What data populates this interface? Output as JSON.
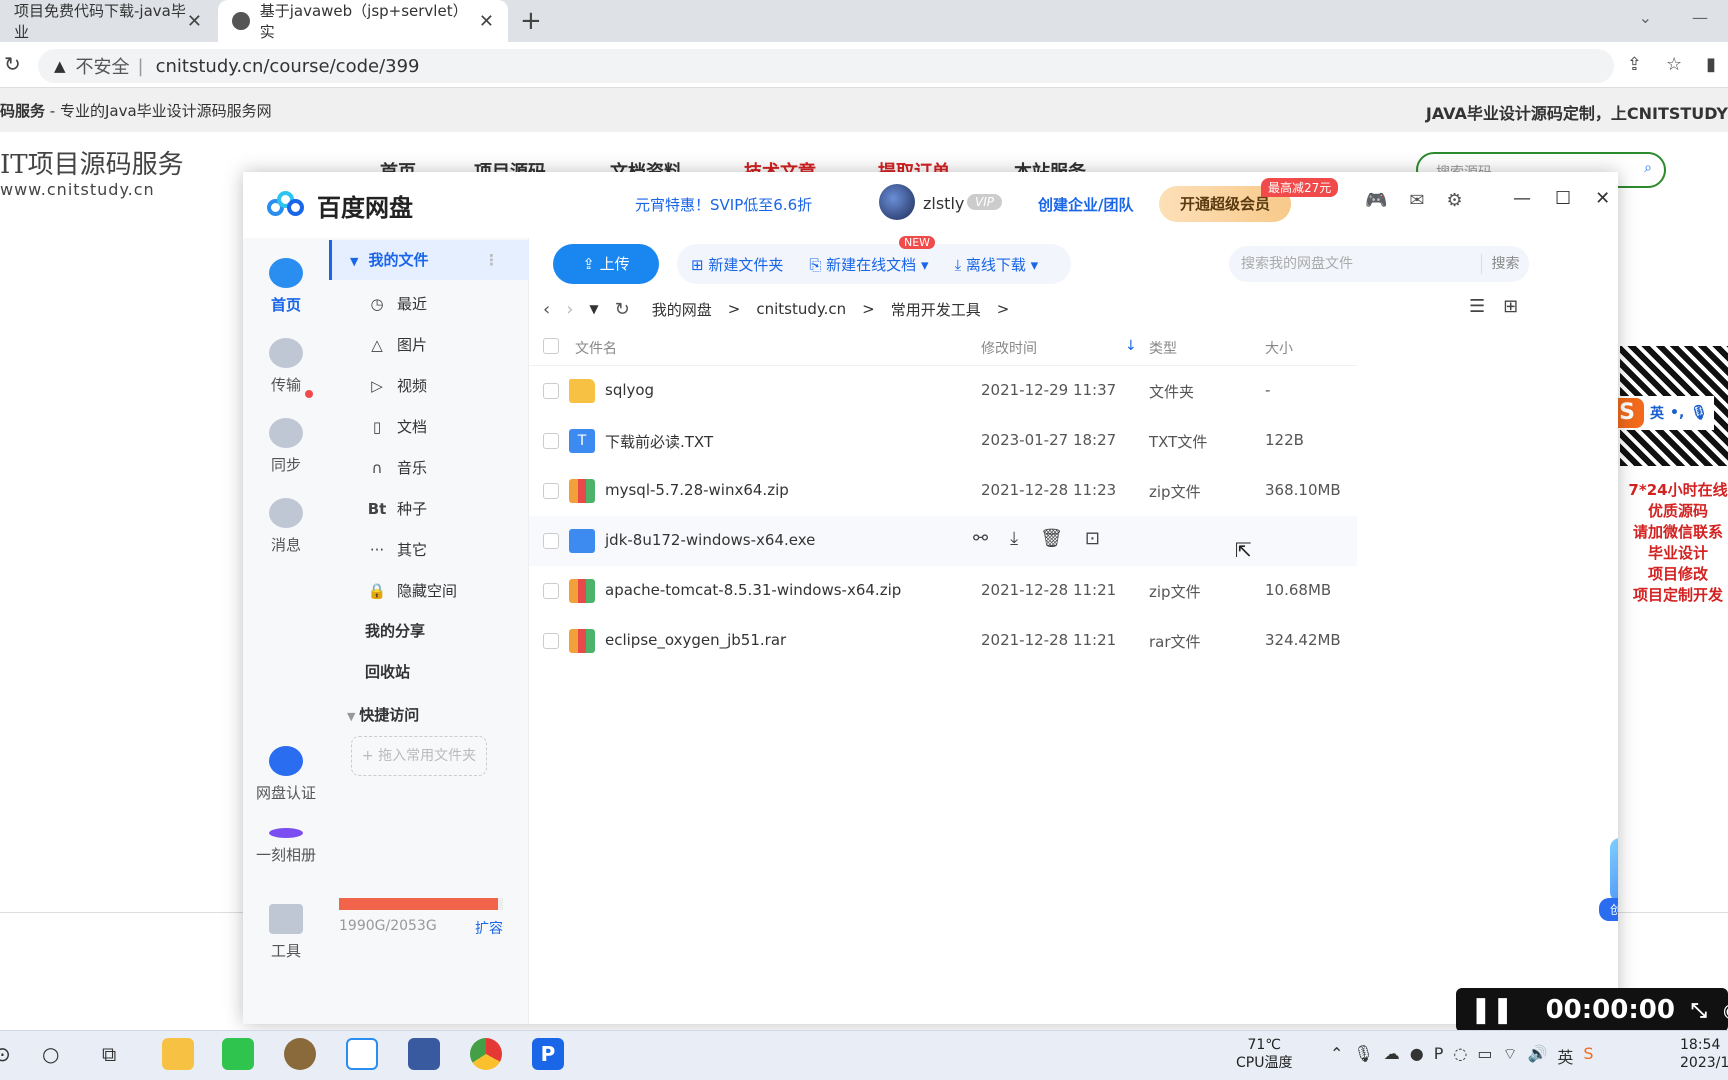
{
  "browser": {
    "tabs": [
      {
        "title": "项目免费代码下载-java毕业"
      },
      {
        "title": "基于javaweb（jsp+servlet）实"
      }
    ],
    "address": {
      "security": "不安全",
      "url": "cnitstudy.cn/course/code/399"
    }
  },
  "site": {
    "band_left_bold": "码服务",
    "band_left": " - 专业的Java毕业设计源码服务网",
    "band_right": "JAVA毕业设计源码定制，上CNITSTUDY",
    "logo": "IT项目源码服务",
    "logo_url": "www.cnitstudy.cn",
    "nav": [
      "首页",
      "项目源码",
      "文档资料",
      "技术文章",
      "提取订单",
      "本站服务"
    ],
    "search_placeholder": "搜索源码",
    "side_text": [
      "7*24小时在线",
      "优质源码",
      "请加微信联系",
      "毕业设计",
      "项目修改",
      "项目定制开发"
    ],
    "ime": "英"
  },
  "baidu": {
    "app_name": "百度网盘",
    "promo": "元宵特惠！SVIP低至6.6折",
    "username": "zlstly",
    "vip_badge": "VIP",
    "enterprise": "创建企业/团队",
    "super_member": "开通超级会员",
    "discount": "最高减27元",
    "rail": [
      {
        "label": "首页"
      },
      {
        "label": "传输"
      },
      {
        "label": "同步"
      },
      {
        "label": "消息"
      },
      {
        "label": "网盘认证"
      },
      {
        "label": "一刻相册"
      },
      {
        "label": "工具"
      }
    ],
    "sidebar": {
      "my_files": "我的文件",
      "items": [
        {
          "icon": "clock-icon",
          "label": "最近"
        },
        {
          "icon": "image-icon",
          "label": "图片"
        },
        {
          "icon": "video-icon",
          "label": "视频"
        },
        {
          "icon": "document-icon",
          "label": "文档"
        },
        {
          "icon": "headphones-icon",
          "label": "音乐"
        },
        {
          "icon": "bt-icon",
          "label": "种子"
        },
        {
          "icon": "more-icon",
          "label": "其它"
        },
        {
          "icon": "lock-icon",
          "label": "隐藏空间"
        }
      ],
      "my_share": "我的分享",
      "recycle": "回收站",
      "quick_access": "快捷访问",
      "add_folder": "+ 拖入常用文件夹",
      "quota": "1990G/2053G",
      "quota_fraction": 0.969,
      "expand": "扩容"
    },
    "toolbar": {
      "upload": "上传",
      "new_folder": "新建文件夹",
      "new_online_doc": "新建在线文档",
      "new_badge": "NEW",
      "offline_download": "离线下载",
      "search_placeholder": "搜索我的网盘文件",
      "search_button": "搜索"
    },
    "breadcrumb": [
      "我的网盘",
      "cnitstudy.cn",
      "常用开发工具"
    ],
    "columns": {
      "name": "文件名",
      "modified": "修改时间",
      "type": "类型",
      "size": "大小"
    },
    "files": [
      {
        "name": "sqlyog",
        "modified": "2021-12-29 11:37",
        "type": "文件夹",
        "size": "-",
        "kind": "folder"
      },
      {
        "name": "下载前必读.TXT",
        "modified": "2023-01-27 18:27",
        "type": "TXT文件",
        "size": "122B",
        "kind": "txt"
      },
      {
        "name": "mysql-5.7.28-winx64.zip",
        "modified": "2021-12-28 11:23",
        "type": "zip文件",
        "size": "368.10MB",
        "kind": "zip"
      },
      {
        "name": "jdk-8u172-windows-x64.exe",
        "modified": "",
        "type": "",
        "size": "",
        "kind": "exe"
      },
      {
        "name": "apache-tomcat-8.5.31-windows-x64.zip",
        "modified": "2021-12-28 11:21",
        "type": "zip文件",
        "size": "10.68MB",
        "kind": "zip"
      },
      {
        "name": "eclipse_oxygen_jb51.rar",
        "modified": "2021-12-28 11:21",
        "type": "rar文件",
        "size": "324.42MB",
        "kind": "zip"
      }
    ],
    "team_badge": "创建你的团队"
  },
  "recorder": {
    "time": "00:00:00"
  },
  "taskbar": {
    "temp": "71℃",
    "temp_label": "CPU温度",
    "ime": "英",
    "time": "18:54",
    "date": "2023/1"
  }
}
